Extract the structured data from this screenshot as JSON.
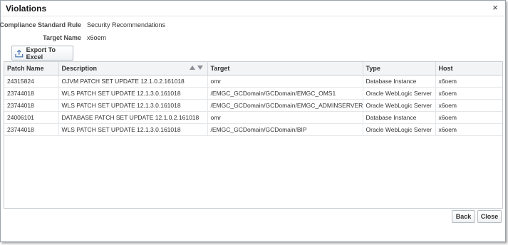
{
  "dialog": {
    "title": "Violations",
    "close_glyph": "×"
  },
  "info": {
    "rule_label": "Compliance Standard Rule",
    "rule_value": "Security Recommendations",
    "target_label": "Target Name",
    "target_value": "x6oem"
  },
  "toolbar": {
    "export_label": "Export To Excel",
    "export_icon": "export-icon"
  },
  "table": {
    "columns": [
      "Patch Name",
      "Description",
      "Target",
      "Type",
      "Host"
    ],
    "rows": [
      [
        "24315824",
        "OJVM PATCH SET UPDATE 12.1.0.2.161018",
        "omr",
        "Database Instance",
        "x6oem"
      ],
      [
        "23744018",
        "WLS PATCH SET UPDATE 12.1.3.0.161018",
        "/EMGC_GCDomain/GCDomain/EMGC_OMS1",
        "Oracle WebLogic Server",
        "x6oem"
      ],
      [
        "23744018",
        "WLS PATCH SET UPDATE 12.1.3.0.161018",
        "/EMGC_GCDomain/GCDomain/EMGC_ADMINSERVER",
        "Oracle WebLogic Server",
        "x6oem"
      ],
      [
        "24006101",
        "DATABASE PATCH SET UPDATE 12.1.0.2.161018",
        "omr",
        "Database Instance",
        "x6oem"
      ],
      [
        "23744018",
        "WLS PATCH SET UPDATE 12.1.3.0.161018",
        "/EMGC_GCDomain/GCDomain/BIP",
        "Oracle WebLogic Server",
        "x6oem"
      ]
    ]
  },
  "footer": {
    "back_label": "Back",
    "close_label": "Close"
  }
}
